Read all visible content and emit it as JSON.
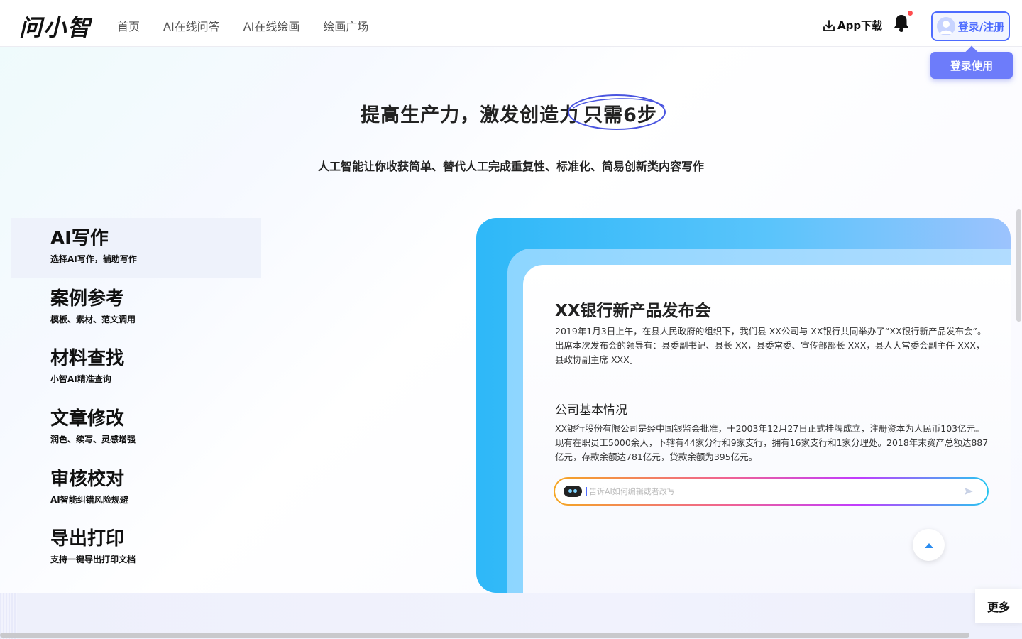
{
  "header": {
    "logo": "问小智",
    "nav": [
      "首页",
      "AI在线问答",
      "AI在线绘画",
      "绘画广场"
    ],
    "download_label": "App下载",
    "login_label": "登录/注册",
    "login_tip": "登录使用"
  },
  "hero": {
    "title_main": "提高生产力，激发创造力",
    "title_highlight": "只需6步",
    "subtitle": "人工智能让你收获简单、替代人工完成重复性、标准化、简易创新类内容写作"
  },
  "features": [
    {
      "title": "AI写作",
      "desc": "选择AI写作，辅助写作"
    },
    {
      "title": "案例参考",
      "desc": "模板、素材、范文调用"
    },
    {
      "title": "材料查找",
      "desc": "小智AI精准查询"
    },
    {
      "title": "文章修改",
      "desc": "润色、续写、灵感增强"
    },
    {
      "title": "审核校对",
      "desc": "AI智能纠错风险规避"
    },
    {
      "title": "导出打印",
      "desc": "支持一键导出打印文档"
    }
  ],
  "showcase": {
    "doc_title": "XX银行新产品发布会",
    "paragraph1": "2019年1月3日上午，在县人民政府的组织下，我们县 XX公司与 XX银行共同举办了“XX银行新产品发布会”。出席本次发布会的领导有：县委副书记、县长 XX，县委常委、宣传部部长 XXX，县人大常委会副主任 XXX，县政协副主席 XXX。",
    "section_title": "公司基本情况",
    "paragraph2": "XX银行股份有限公司是经中国银监会批准，于2003年12月27日正式挂牌成立，注册资本为人民币103亿元。现有在职员工5000余人，下辖有44家分行和9家支行，拥有16家支行和1家分理处。2018年末资产总额达887亿元，存款余额达781亿元，贷款余额为395亿元。",
    "input_placeholder": "告诉AI如何编辑或者改写"
  },
  "more_label": "更多",
  "colors": {
    "accent": "#4d6bff",
    "tip": "#6d7cfa",
    "panel_blue": "#2eb8f8"
  }
}
